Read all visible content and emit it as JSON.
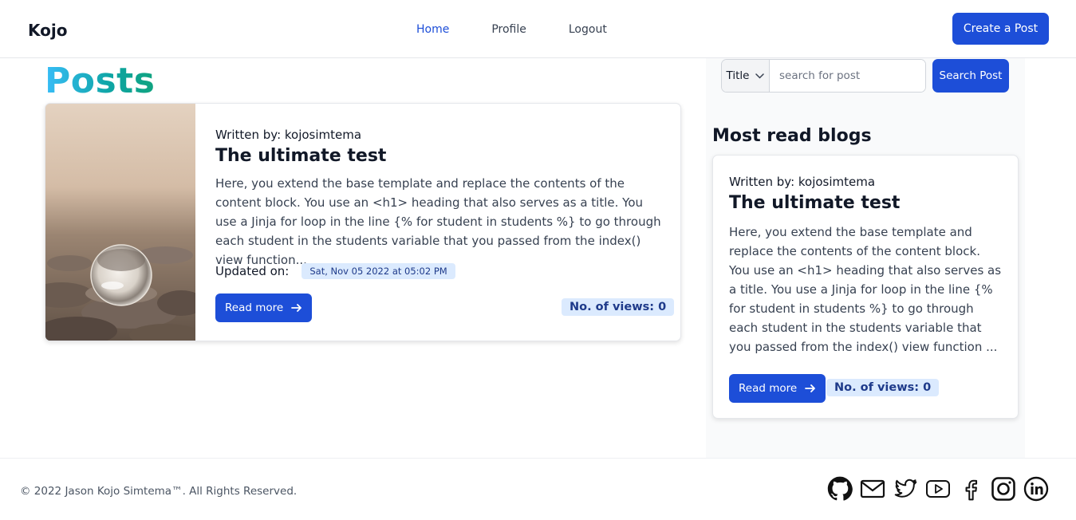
{
  "nav": {
    "brand": "Kojo",
    "links": [
      {
        "label": "Home",
        "active": true
      },
      {
        "label": "Profile",
        "active": false
      },
      {
        "label": "Logout",
        "active": false
      }
    ],
    "create_label": "Create a Post"
  },
  "main": {
    "heading": "Posts",
    "post": {
      "author": "Written by: kojosimtema",
      "title": "The ultimate test",
      "excerpt": "Here, you extend the base template and replace the contents of the content block. You use an <h1> heading that also serves as a title. You use a Jinja for loop in the line {% for student in students %} to go through each student in the students variable that you passed from the index() view function...",
      "updated_label": "Updated on:",
      "updated_date": "Sat, Nov 05 2022 at 05:02 PM",
      "read_more": "Read more",
      "views": "No. of views: 0"
    }
  },
  "sidebar": {
    "search": {
      "select_value": "Title",
      "placeholder": "search for post",
      "button": "Search Post"
    },
    "most_read_heading": "Most read blogs",
    "card": {
      "author": "Written by: kojosimtema",
      "title": "The ultimate test",
      "excerpt": "Here, you extend the base template and replace the contents of the content block. You use an <h1> heading that also serves as a title. You use a Jinja for loop in the line {% for student in students %} to go through each student in the students variable that you passed from the index() view function ...",
      "read_more": "Read more",
      "views": "No. of views: 0"
    }
  },
  "footer": {
    "copyright": "© 2022 Jason Kojo Simtema™. All Rights Reserved.",
    "social_icons": [
      "github-icon",
      "mail-icon",
      "twitter-icon",
      "youtube-icon",
      "facebook-icon",
      "instagram-icon",
      "linkedin-icon"
    ]
  },
  "colors": {
    "primary": "#1d4ed8",
    "badge_bg": "#dbeafe",
    "badge_text": "#1e3a8a"
  }
}
